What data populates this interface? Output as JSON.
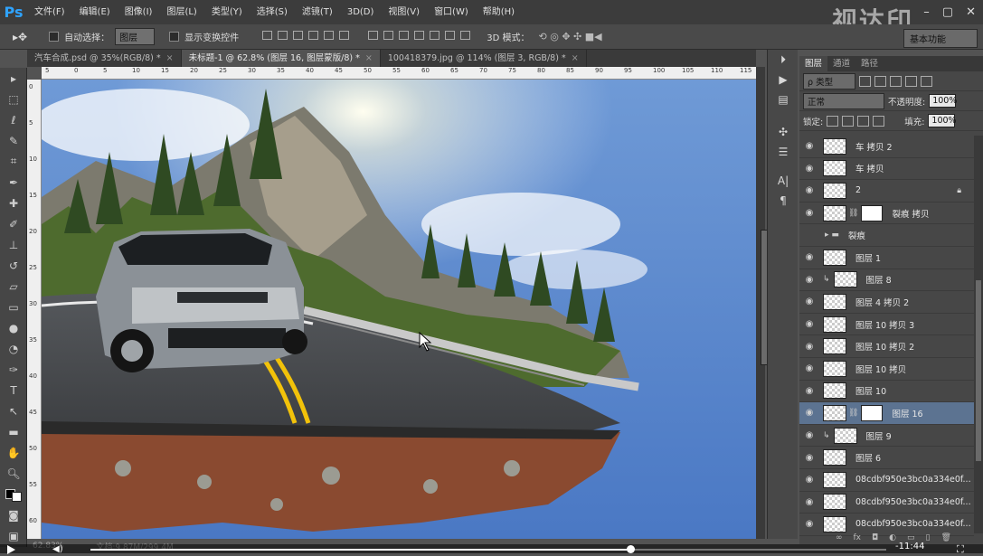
{
  "app": {
    "logo": "Ps"
  },
  "menu": [
    "文件(F)",
    "编辑(E)",
    "图像(I)",
    "图层(L)",
    "类型(Y)",
    "选择(S)",
    "滤镜(T)",
    "3D(D)",
    "视图(V)",
    "窗口(W)",
    "帮助(H)"
  ],
  "watermark": "视达印",
  "options": {
    "auto_select_label": "自动选择：",
    "auto_select_value": "图层",
    "transform_label": "显示变换控件",
    "mode3d_label": "3D 模式：",
    "workspace": "基本功能"
  },
  "tabs": [
    {
      "label": "汽车合成.psd @ 35%(RGB/8) *",
      "active": false
    },
    {
      "label": "未标题-1 @ 62.8% (图层 16, 图层蒙版/8) *",
      "active": true
    },
    {
      "label": "100418379.jpg @ 114% (图层 3, RGB/8) *",
      "active": false
    }
  ],
  "ruler_top": [
    "5",
    "0",
    "5",
    "10",
    "15",
    "20",
    "25",
    "30",
    "35",
    "40",
    "45",
    "50",
    "55",
    "60",
    "65",
    "70",
    "75",
    "80",
    "85",
    "90",
    "95",
    "100",
    "105",
    "110",
    "115"
  ],
  "ruler_left": [
    "0",
    "5",
    "10",
    "15",
    "20",
    "25",
    "30",
    "35",
    "40",
    "45",
    "50",
    "55",
    "60"
  ],
  "status": {
    "zoom": "62.83%",
    "doc": "文档:9.87M/299.4M"
  },
  "player": {
    "time": "-11:44",
    "progress": 0.68
  },
  "layers_panel": {
    "tabs": [
      "图层",
      "通道",
      "路径"
    ],
    "filter": "类型",
    "blend": "正常",
    "opacity_label": "不透明度:",
    "opacity": "100%",
    "lock_label": "锁定:",
    "fill_label": "填充:",
    "fill": "100%",
    "layers": [
      {
        "name": "车 拷贝 2",
        "eye": true,
        "mask": false,
        "selected": false
      },
      {
        "name": "车 拷贝",
        "eye": true,
        "mask": false,
        "selected": false
      },
      {
        "name": "2",
        "eye": true,
        "mask": false,
        "selected": false,
        "locked": true
      },
      {
        "name": "裂痕 拷贝",
        "eye": true,
        "mask": true,
        "selected": false
      },
      {
        "name": "裂痕",
        "eye": false,
        "mask": false,
        "selected": false,
        "group": true
      },
      {
        "name": "图层 1",
        "eye": true,
        "mask": false,
        "selected": false
      },
      {
        "name": "图层 8",
        "eye": true,
        "mask": false,
        "selected": false,
        "clip": true
      },
      {
        "name": "图层 4 拷贝 2",
        "eye": true,
        "mask": false,
        "selected": false
      },
      {
        "name": "图层 10 拷贝 3",
        "eye": true,
        "mask": false,
        "selected": false
      },
      {
        "name": "图层 10 拷贝 2",
        "eye": true,
        "mask": false,
        "selected": false
      },
      {
        "name": "图层 10 拷贝",
        "eye": true,
        "mask": false,
        "selected": false
      },
      {
        "name": "图层 10",
        "eye": true,
        "mask": false,
        "selected": false
      },
      {
        "name": "图层 16",
        "eye": true,
        "mask": true,
        "selected": true
      },
      {
        "name": "图层 9",
        "eye": true,
        "mask": false,
        "selected": false,
        "clip": true
      },
      {
        "name": "图层 6",
        "eye": true,
        "mask": false,
        "selected": false
      },
      {
        "name": "08cdbf950e3bc0a334e0f...",
        "eye": true,
        "mask": false,
        "selected": false
      },
      {
        "name": "08cdbf950e3bc0a334e0f...",
        "eye": true,
        "mask": false,
        "selected": false
      },
      {
        "name": "08cdbf950e3bc0a334e0f...",
        "eye": true,
        "mask": false,
        "selected": false
      }
    ]
  }
}
